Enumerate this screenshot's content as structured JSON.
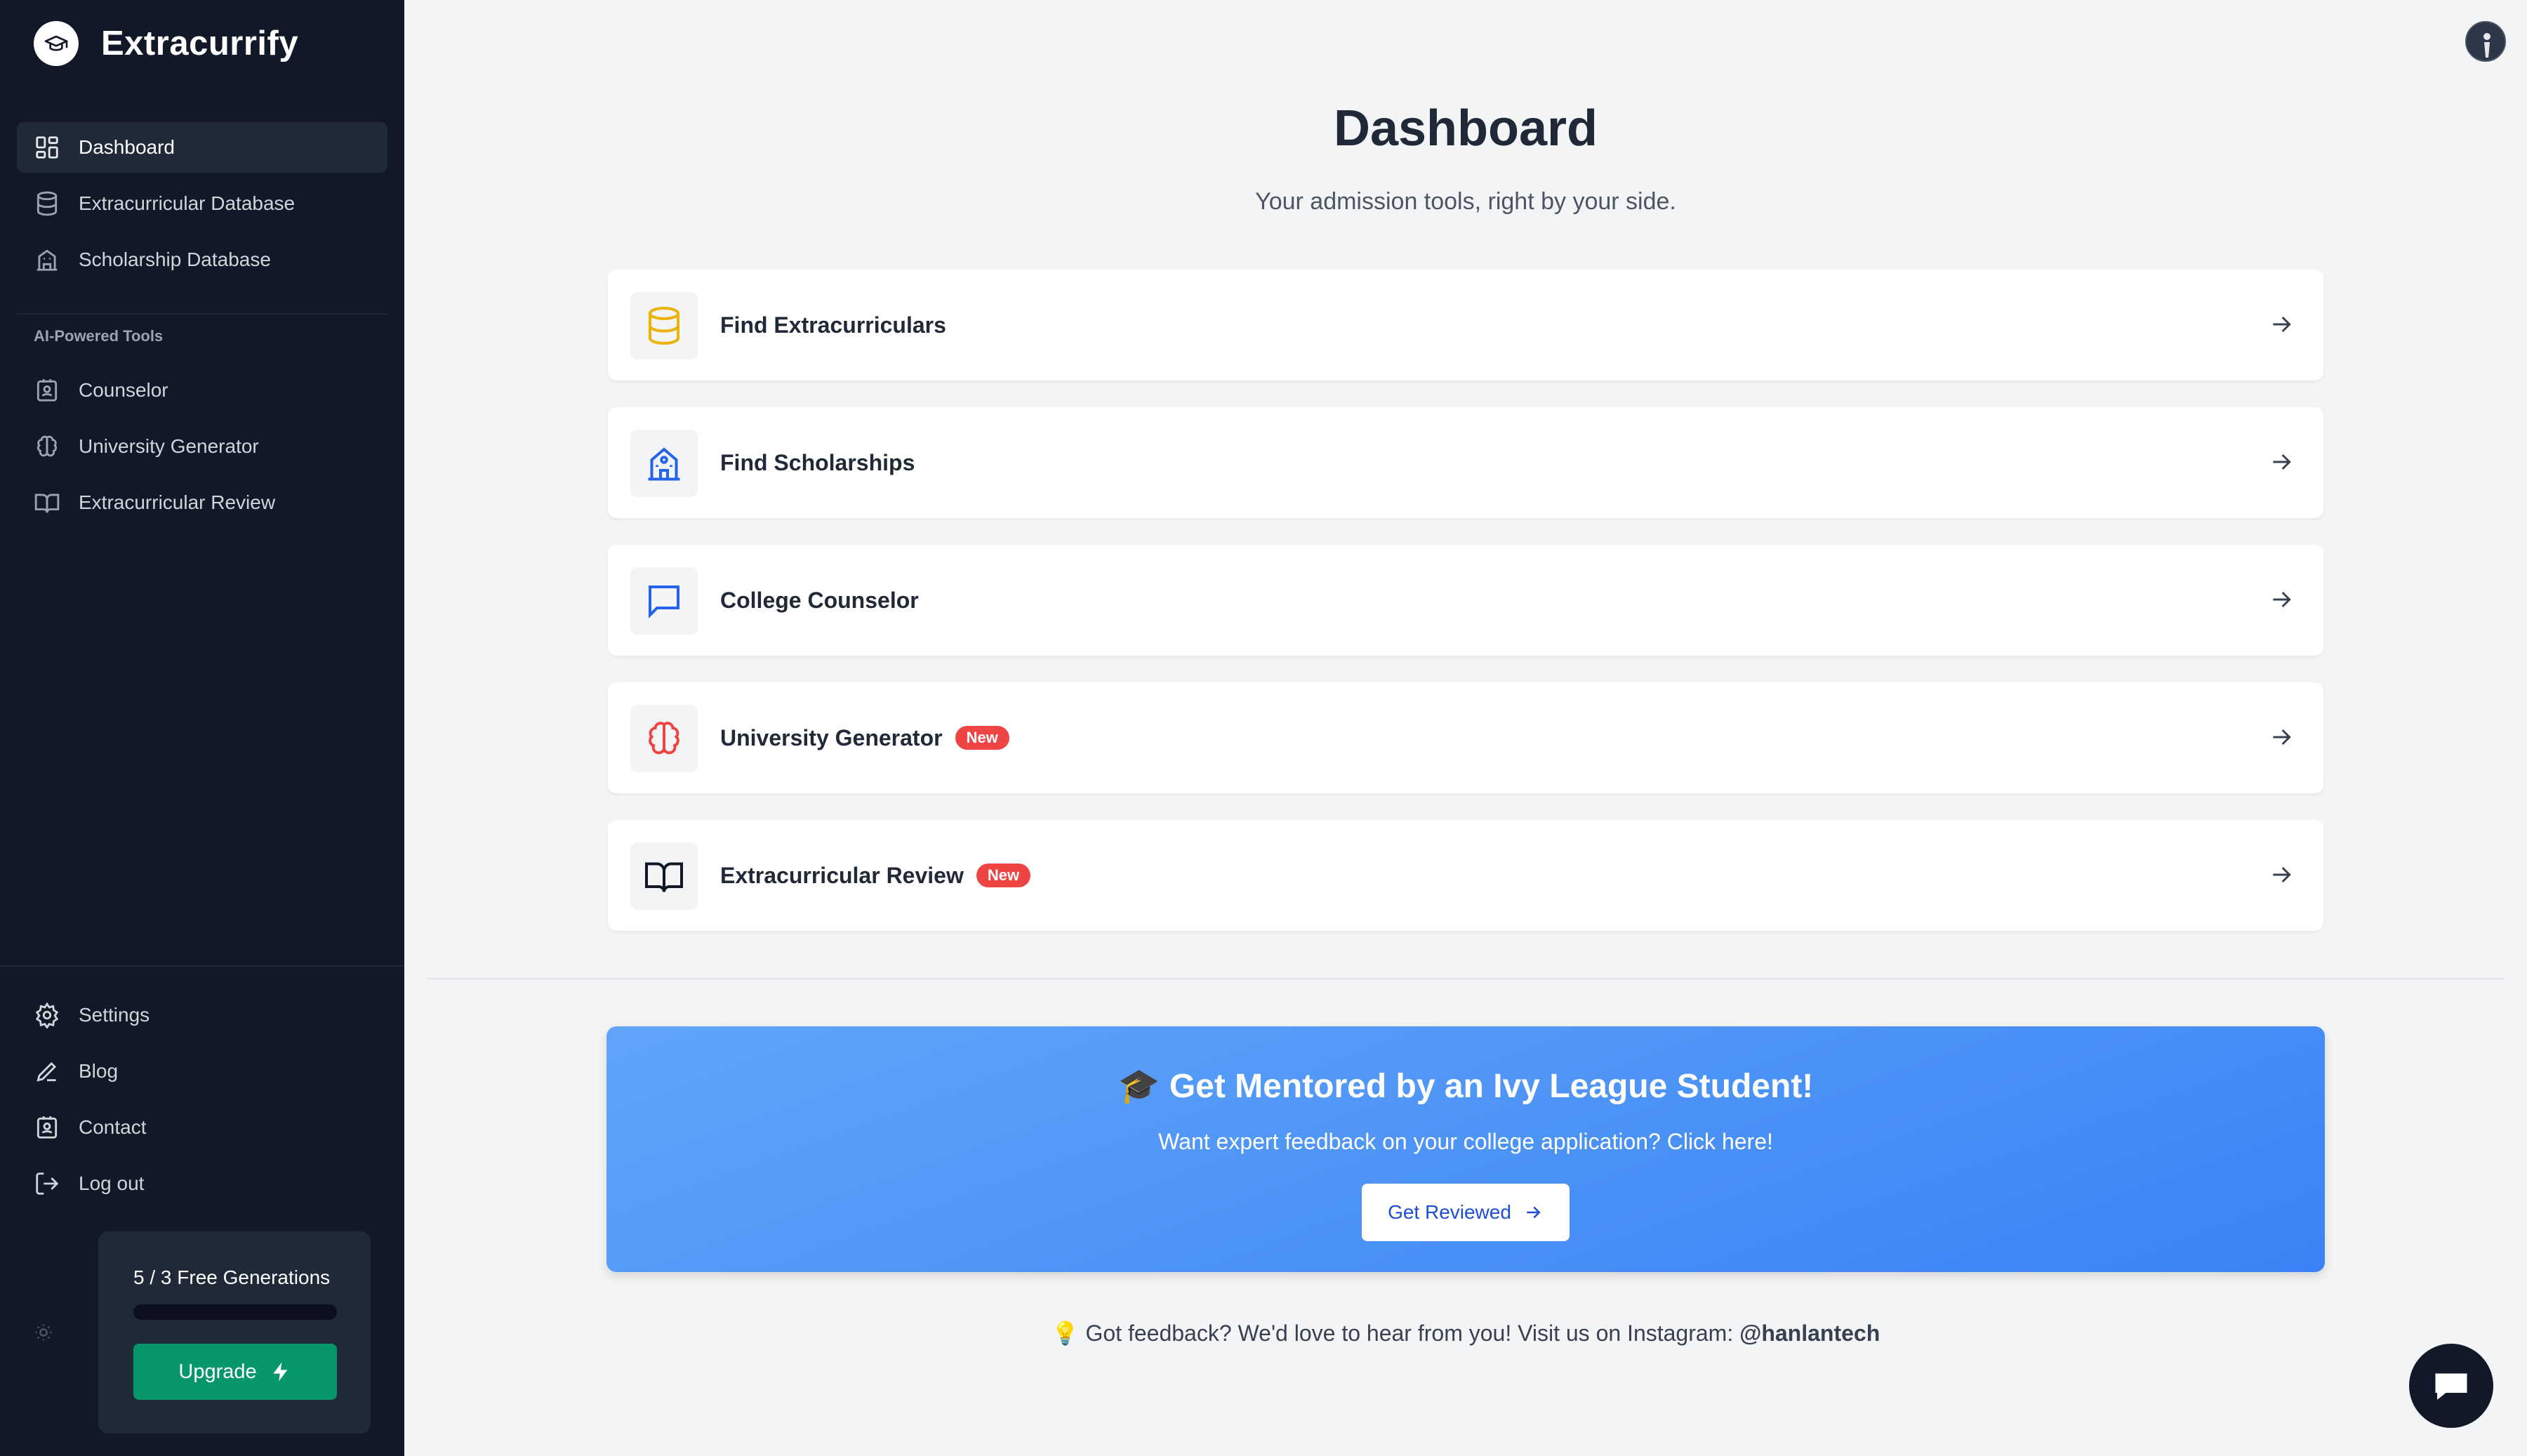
{
  "brand": {
    "name": "Extracurrify"
  },
  "sidebar": {
    "items": [
      {
        "label": "Dashboard",
        "icon": "dashboard-grid-icon",
        "active": true
      },
      {
        "label": "Extracurricular Database",
        "icon": "database-icon"
      },
      {
        "label": "Scholarship Database",
        "icon": "building-icon"
      }
    ],
    "section_label": "AI-Powered Tools",
    "ai_items": [
      {
        "label": "Counselor",
        "icon": "contact-badge-icon"
      },
      {
        "label": "University Generator",
        "icon": "brain-icon"
      },
      {
        "label": "Extracurricular Review",
        "icon": "book-open-icon"
      }
    ],
    "bottom_items": [
      {
        "label": "Settings",
        "icon": "gear-icon"
      },
      {
        "label": "Blog",
        "icon": "pen-icon"
      },
      {
        "label": "Contact",
        "icon": "contact-badge-icon"
      },
      {
        "label": "Log out",
        "icon": "logout-icon"
      }
    ],
    "credits": {
      "text": "5 / 3 Free Generations",
      "used": 5,
      "total": 3,
      "upgrade_label": "Upgrade"
    }
  },
  "main": {
    "title": "Dashboard",
    "subtitle": "Your admission tools, right by your side.",
    "cards": [
      {
        "title": "Find Extracurriculars",
        "icon": "database-icon",
        "icon_color": "#eab308"
      },
      {
        "title": "Find Scholarships",
        "icon": "school-building-icon",
        "icon_color": "#2563eb"
      },
      {
        "title": "College Counselor",
        "icon": "chat-bubble-icon",
        "icon_color": "#2563eb"
      },
      {
        "title": "University Generator",
        "icon": "brain-icon",
        "icon_color": "#ef4444",
        "badge": "New"
      },
      {
        "title": "Extracurricular Review",
        "icon": "book-open-icon",
        "icon_color": "#111827",
        "badge": "New"
      }
    ],
    "promo": {
      "title": "🎓 Get Mentored by an Ivy League Student!",
      "text": "Want expert feedback on your college application? Click here!",
      "button_label": "Get Reviewed"
    },
    "feedback": {
      "text": "💡 Got feedback? We'd love to hear from you! Visit us on Instagram: ",
      "handle": "@hanlantech"
    }
  },
  "colors": {
    "sidebar_bg": "#111827",
    "accent_green": "#059669",
    "accent_blue": "#3b82f6",
    "badge_red": "#ef4444"
  }
}
